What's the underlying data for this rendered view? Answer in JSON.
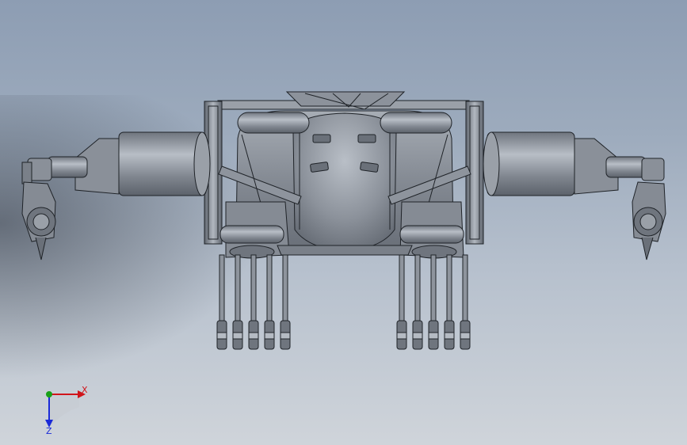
{
  "viewport": {
    "background_top": "#8d9db3",
    "background_bottom": "#cfd4da",
    "model_color": "#8a8f97",
    "edge_color": "#202428"
  },
  "triad": {
    "x_label": "X",
    "y_label": "",
    "z_label": "Z",
    "x_color": "#d0141a",
    "y_color": "#18a018",
    "z_color": "#1a2ad8"
  }
}
